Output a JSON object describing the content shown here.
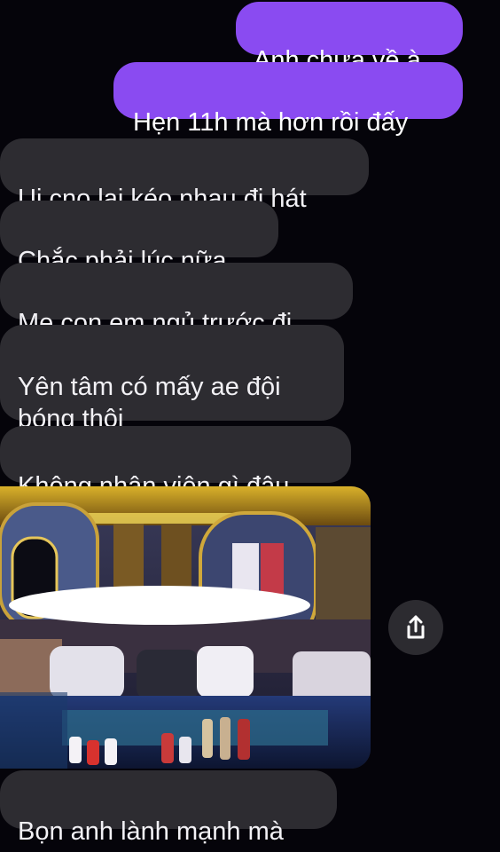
{
  "messages": [
    {
      "direction": "outgoing",
      "text": "Anh chưa về à"
    },
    {
      "direction": "outgoing",
      "text": "Hẹn 11h mà hơn rồi đấy"
    },
    {
      "direction": "incoming",
      "text": "Ui cno lại kéo nhau đi hát"
    },
    {
      "direction": "incoming",
      "text": "Chắc phải lúc nữa"
    },
    {
      "direction": "incoming",
      "text": "Mẹ con em ngủ trước đi"
    },
    {
      "direction": "incoming",
      "text": "Yên tâm có mấy ae đội\nbóng thôi"
    },
    {
      "direction": "incoming",
      "text": "Không nhân viên gì đâu"
    },
    {
      "direction": "incoming",
      "text": "Bọn anh lành mạnh mà"
    }
  ],
  "photo": {
    "icon": "share-icon"
  },
  "colors": {
    "background": "#05040a",
    "outgoing_bubble": "#8a4bf1",
    "incoming_bubble": "#2d2c31",
    "text": "#f2f1f5"
  }
}
